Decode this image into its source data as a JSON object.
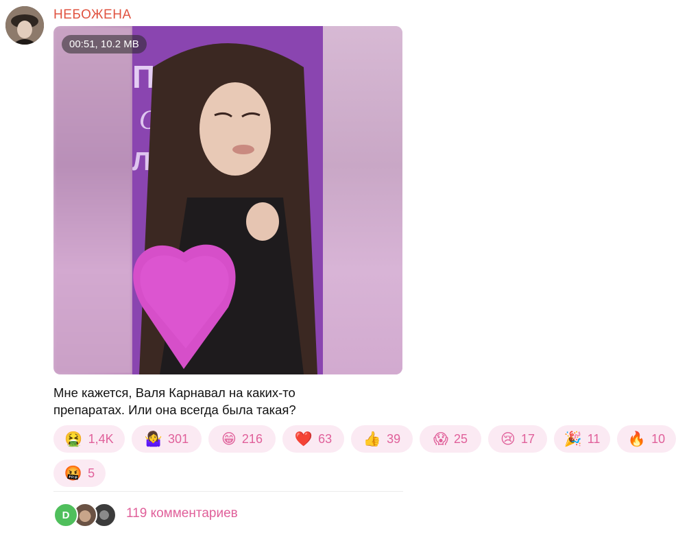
{
  "channel": {
    "name": "НЕБОЖЕНА",
    "avatar_icon": "channel-avatar"
  },
  "post": {
    "video": {
      "duration_size": "00:51, 10.2 MB"
    },
    "caption_line1": "Мне кажется, Валя Карнавал на каких-то",
    "caption_line2": "препаратах. Или она всегда была такая?"
  },
  "reactions": [
    {
      "emoji": "🤮",
      "icon": "vomit-face-icon",
      "count": "1,4K"
    },
    {
      "emoji": "🤷‍♀️",
      "icon": "shrug-icon",
      "count": "301"
    },
    {
      "emoji": "😁",
      "icon": "grin-icon",
      "count": "216"
    },
    {
      "emoji": "❤️",
      "icon": "heart-icon",
      "count": "63"
    },
    {
      "emoji": "👍",
      "icon": "thumbs-up-icon",
      "count": "39"
    },
    {
      "emoji": "😱",
      "icon": "scream-icon",
      "count": "25"
    },
    {
      "emoji": "😢",
      "icon": "crying-face-icon",
      "count": "17"
    },
    {
      "emoji": "🎉",
      "icon": "party-popper-icon",
      "count": "11"
    },
    {
      "emoji": "🔥",
      "icon": "fire-icon",
      "count": "10"
    },
    {
      "emoji": "🤬",
      "icon": "cursing-face-icon",
      "count": "5"
    }
  ],
  "comments": {
    "avatar_letter": "D",
    "label": "119 комментариев"
  },
  "colors": {
    "accent": "#e0609a",
    "name": "#e0523f",
    "reaction_bg": "#fbeaf3"
  }
}
